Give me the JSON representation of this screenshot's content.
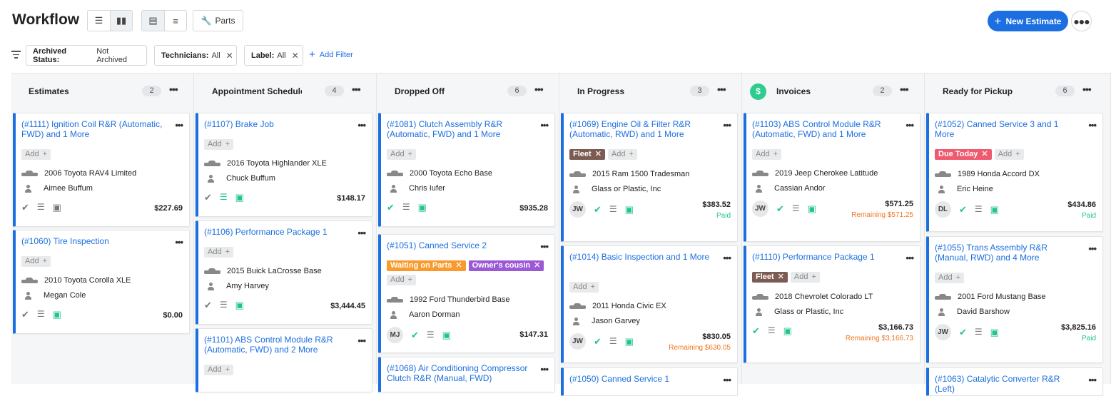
{
  "header": {
    "title": "Workflow",
    "parts_label": "Parts",
    "new_estimate_label": "New Estimate"
  },
  "filters": {
    "chips": [
      {
        "key": "Archived Status:",
        "value": "Not Archived",
        "removable": false
      },
      {
        "key": "Technicians:",
        "value": "All",
        "removable": true
      },
      {
        "key": "Label:",
        "value": "All",
        "removable": true
      }
    ],
    "add_filter_label": "Add Filter"
  },
  "colors": {
    "accent": "#1c6fe0",
    "paid": "#22c38e",
    "remaining": "#f0761f",
    "tag_fleet": "#7b5b52",
    "tag_due_today": "#ef5a6f",
    "tag_waiting_on_parts": "#f89a2c",
    "tag_owners_cousin": "#9b59d6"
  },
  "columns": [
    {
      "name": "Estimates",
      "count": "2",
      "cards": [
        {
          "title": "(#1111) Ignition Coil R&R (Automatic, FWD) and 1 More",
          "tags": [],
          "add_label": "Add",
          "vehicle": "2006 Toyota RAV4 Limited",
          "customer": "Aimee Buffum",
          "avatar": "",
          "check_green": false,
          "calendar_green": false,
          "amount": "$227.69",
          "status": ""
        },
        {
          "title": "(#1060) Tire Inspection",
          "tags": [],
          "add_label": "Add",
          "vehicle": "2010 Toyota Corolla XLE",
          "customer": "Megan Cole",
          "avatar": "",
          "check_green": false,
          "calendar_green": true,
          "amount": "$0.00",
          "status": ""
        }
      ]
    },
    {
      "name": "Appointment Scheduled",
      "count": "4",
      "cards": [
        {
          "title": "(#1107) Brake Job",
          "tags": [],
          "add_label": "Add",
          "vehicle": "2016 Toyota Highlander XLE",
          "customer": "Chuck Buffum",
          "avatar": "",
          "check_green": false,
          "calendar_green": true,
          "list_green": true,
          "amount": "$148.17",
          "status": ""
        },
        {
          "title": "(#1106) Performance Package 1",
          "tags": [],
          "add_label": "Add",
          "vehicle": "2015 Buick LaCrosse Base",
          "customer": "Amy Harvey",
          "avatar": "",
          "check_green": false,
          "calendar_green": true,
          "amount": "$3,444.45",
          "status": ""
        },
        {
          "title": "(#1101) ABS Control Module R&R (Automatic, FWD) and 2 More",
          "tags": [],
          "add_label": "Add"
        }
      ]
    },
    {
      "name": "Dropped Off",
      "count": "6",
      "cards": [
        {
          "title": "(#1081) Clutch Assembly R&R (Automatic, FWD) and 1 More",
          "tags": [],
          "add_label": "Add",
          "vehicle": "2000 Toyota Echo Base",
          "customer": "Chris Iufer",
          "avatar": "",
          "check_green": true,
          "calendar_green": true,
          "amount": "$935.28",
          "status": ""
        },
        {
          "title": "(#1051) Canned Service 2",
          "tags": [
            "Waiting on Parts",
            "Owner's cousin"
          ],
          "add_label": "Add",
          "vehicle": "1992 Ford Thunderbird Base",
          "customer": "Aaron Dorman",
          "avatar": "MJ",
          "check_green": true,
          "calendar_green": true,
          "amount": "$147.31",
          "status": ""
        },
        {
          "title": "(#1068) Air Conditioning Compressor Clutch R&R (Manual, FWD)"
        }
      ]
    },
    {
      "name": "In Progress",
      "count": "3",
      "cards": [
        {
          "title": "(#1069) Engine Oil & Filter R&R (Automatic, RWD) and 1 More",
          "tags": [
            "Fleet"
          ],
          "add_label": "Add",
          "vehicle": "2015 Ram 1500 Tradesman",
          "customer": "Glass or Plastic, Inc",
          "avatar": "JW",
          "check_green": true,
          "calendar_green": true,
          "amount": "$383.52",
          "status": "Paid"
        },
        {
          "title": "(#1014) Basic Inspection and 1 More",
          "tags": [],
          "add_label": "Add",
          "vehicle": "2011 Honda Civic EX",
          "customer": "Jason Garvey",
          "avatar": "JW",
          "check_green": true,
          "calendar_green": true,
          "amount": "$830.05",
          "status": "Remaining $630.05"
        },
        {
          "title": "(#1050) Canned Service 1"
        }
      ]
    },
    {
      "name": "Invoices",
      "count": "2",
      "dollar": "$",
      "cards": [
        {
          "title": "(#1103) ABS Control Module R&R (Automatic, FWD) and 1 More",
          "tags": [],
          "add_label": "Add",
          "vehicle": "2019 Jeep Cherokee Latitude",
          "customer": "Cassian Andor",
          "avatar": "JW",
          "check_green": true,
          "calendar_green": true,
          "amount": "$571.25",
          "status": "Remaining $571.25"
        },
        {
          "title": "(#1110) Performance Package 1",
          "tags": [
            "Fleet"
          ],
          "add_label": "Add",
          "vehicle": "2018 Chevrolet Colorado LT",
          "customer": "Glass or Plastic, Inc",
          "avatar": "",
          "check_green": true,
          "calendar_green": true,
          "amount": "$3,166.73",
          "status": "Remaining $3,166.73"
        }
      ]
    },
    {
      "name": "Ready for Pickup",
      "count": "6",
      "cards": [
        {
          "title": "(#1052) Canned Service 3 and 1 More",
          "tags": [
            "Due Today"
          ],
          "add_label": "Add",
          "vehicle": "1989 Honda Accord DX",
          "customer": "Eric Heine",
          "avatar": "DL",
          "check_green": true,
          "calendar_green": true,
          "amount": "$434.86",
          "status": "Paid"
        },
        {
          "title": "(#1055) Trans Assembly R&R (Manual, RWD) and 4 More",
          "tags": [],
          "add_label": "Add",
          "vehicle": "2001 Ford Mustang Base",
          "customer": "David Barshow",
          "avatar": "JW",
          "check_green": true,
          "calendar_green": true,
          "amount": "$3,825.16",
          "status": "Paid"
        },
        {
          "title": "(#1063) Catalytic Converter R&R (Left)"
        }
      ]
    }
  ]
}
